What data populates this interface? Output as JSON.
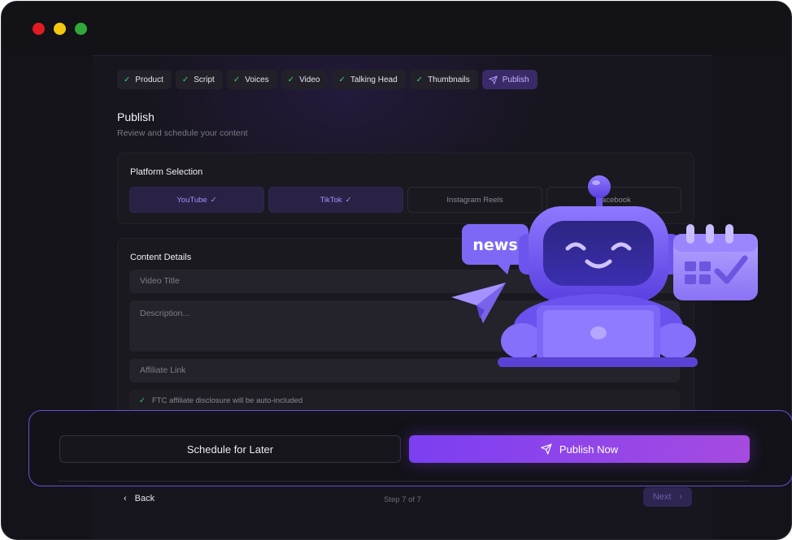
{
  "steps": [
    {
      "label": "Product",
      "state": "done"
    },
    {
      "label": "Script",
      "state": "done"
    },
    {
      "label": "Voices",
      "state": "done"
    },
    {
      "label": "Video",
      "state": "done"
    },
    {
      "label": "Talking Head",
      "state": "done"
    },
    {
      "label": "Thumbnails",
      "state": "done"
    },
    {
      "label": "Publish",
      "state": "active"
    }
  ],
  "header": {
    "title": "Publish",
    "subtitle": "Review and schedule your content"
  },
  "platform_selection": {
    "title": "Platform Selection",
    "platforms": [
      {
        "label": "YouTube",
        "selected": true
      },
      {
        "label": "TikTok",
        "selected": true
      },
      {
        "label": "Instagram Reels",
        "selected": false
      },
      {
        "label": "Facebook",
        "selected": false
      }
    ]
  },
  "content_details": {
    "title": "Content Details",
    "video_title_placeholder": "Video Title",
    "description_placeholder": "Description...",
    "affiliate_link_placeholder": "Affiliate Link",
    "ftc_note": "FTC affiliate disclosure will be auto-included"
  },
  "actions": {
    "schedule_label": "Schedule for Later",
    "publish_label": "Publish Now"
  },
  "footer": {
    "back_label": "Back",
    "step_text": "Step 7 of 7",
    "next_label": "Next"
  },
  "illustration": {
    "news_text": "news"
  },
  "colors": {
    "accent": "#7b3ff2",
    "accent_end": "#a54be0",
    "success": "#3fce6b",
    "background": "#141319"
  },
  "icons": {
    "done_step": "check-icon",
    "active_step": "paper-plane-icon",
    "back": "chevron-left-icon",
    "next": "chevron-right-icon"
  }
}
